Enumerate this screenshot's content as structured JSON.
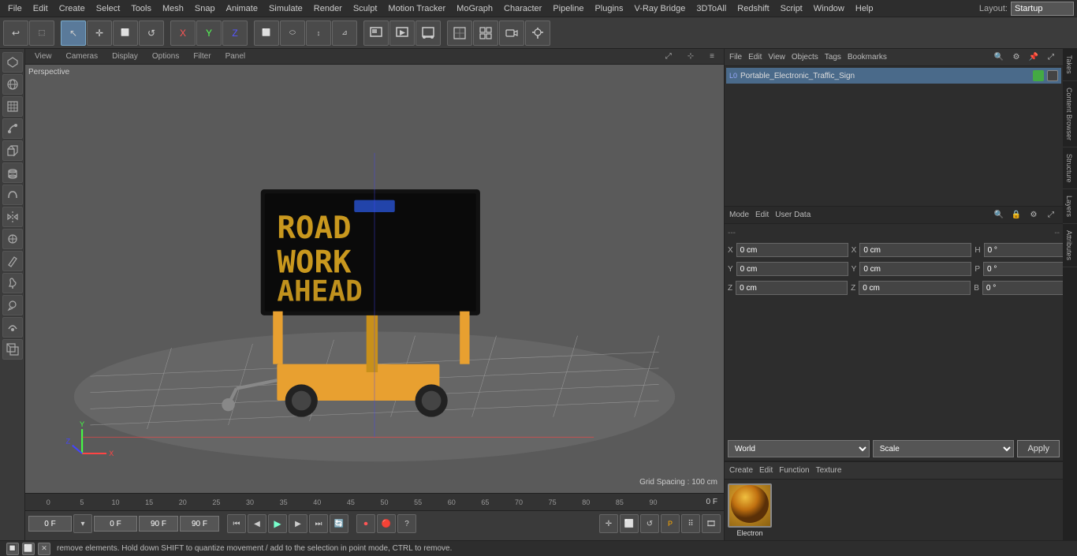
{
  "menubar": {
    "items": [
      "File",
      "Edit",
      "Create",
      "Select",
      "Tools",
      "Mesh",
      "Snap",
      "Animate",
      "Simulate",
      "Render",
      "Sculpt",
      "Motion Tracker",
      "MoGraph",
      "Character",
      "Pipeline",
      "Plugins",
      "V-Ray Bridge",
      "3DToAll",
      "Redshift",
      "Script",
      "Window",
      "Help"
    ],
    "layout_label": "Layout:",
    "layout_value": "Startup"
  },
  "toolbar": {
    "undo_label": "↩",
    "tools": [
      "↩",
      "⬚",
      "✛",
      "↺",
      "▸",
      "X",
      "Y",
      "Z",
      "⬜",
      "⬭",
      "↕",
      "⊿",
      "⊗",
      "▣",
      "○",
      "◎",
      "●",
      "◆",
      "▽",
      "◻",
      "◇"
    ]
  },
  "viewport": {
    "view_menu": "View",
    "cameras_menu": "Cameras",
    "display_menu": "Display",
    "options_menu": "Options",
    "filter_menu": "Filter",
    "panel_menu": "Panel",
    "perspective_label": "Perspective",
    "grid_spacing": "Grid Spacing : 100 cm"
  },
  "timeline": {
    "marks": [
      "0",
      "5",
      "10",
      "15",
      "20",
      "25",
      "30",
      "35",
      "40",
      "45",
      "50",
      "55",
      "60",
      "65",
      "70",
      "75",
      "80",
      "85",
      "90"
    ],
    "current_frame": "0 F",
    "start_frame": "0 F",
    "end_frame": "90 F",
    "end_frame2": "90 F",
    "frame_indicator": "0 F"
  },
  "object_manager": {
    "menu_items": [
      "File",
      "Edit",
      "View",
      "Objects",
      "Tags",
      "Bookmarks"
    ],
    "object_name": "Portable_Electronic_Traffic_Sign",
    "object_icon": "L0"
  },
  "attributes": {
    "mode_label": "Mode",
    "edit_label": "Edit",
    "user_data_label": "User Data",
    "sep1": "---",
    "sep2": "--",
    "x_label": "X",
    "y_label": "Y",
    "z_label": "Z",
    "x_val1": "0 cm",
    "x_val2": "0 cm",
    "h_label": "H",
    "h_val": "0 °",
    "y_val1": "0 cm",
    "y_val2": "0 cm",
    "p_label": "P",
    "p_val": "0 °",
    "z_val1": "0 cm",
    "z_val2": "0 cm",
    "b_label": "B",
    "b_val": "0 °"
  },
  "coordinate_bar": {
    "world_label": "World",
    "scale_label": "Scale",
    "apply_label": "Apply"
  },
  "material": {
    "name": "Electron",
    "preview_type": "sphere"
  },
  "status_bar": {
    "message": "remove elements. Hold down SHIFT to quantize movement / add to the selection in point mode, CTRL to remove."
  },
  "right_tabs": {
    "takes": "Takes",
    "content_browser": "Content Browser",
    "structure": "Structure"
  },
  "layers_tab": "Layers",
  "attributes_tab": "Attributes"
}
